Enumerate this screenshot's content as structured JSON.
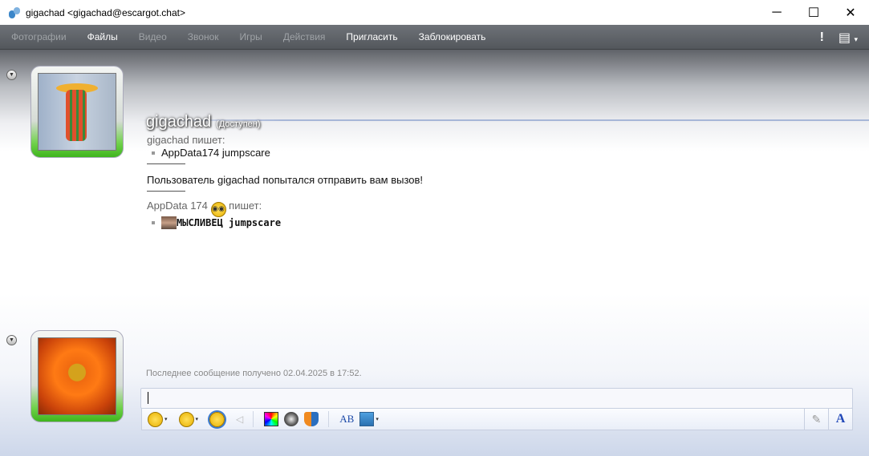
{
  "window": {
    "title": "gigachad <gigachad@escargot.chat>",
    "minimize": "─",
    "maximize": "☐",
    "close": "✕"
  },
  "menu": {
    "items": [
      {
        "label": "Фотографии",
        "enabled": false
      },
      {
        "label": "Файлы",
        "enabled": true
      },
      {
        "label": "Видео",
        "enabled": false
      },
      {
        "label": "Звонок",
        "enabled": false
      },
      {
        "label": "Игры",
        "enabled": false
      },
      {
        "label": "Действия",
        "enabled": false
      },
      {
        "label": "Пригласить",
        "enabled": true
      },
      {
        "label": "Заблокировать",
        "enabled": true
      }
    ],
    "alert": "!",
    "options_icon": "▤",
    "dropdown": "▾"
  },
  "contact": {
    "name": "gigachad",
    "status": "(Доступен)"
  },
  "conversation": {
    "msg1_sender": "gigachad пишет:",
    "msg1_text": "AppData174 jumpscare",
    "system": "Пользователь gigachad попытался отправить вам вызов!",
    "msg2_sender_name": "AppData 174",
    "msg2_sender_suffix": "пишет:",
    "msg2_text": "МЫСЛИВЕЦ jumpscare"
  },
  "last_message": "Последнее сообщение получено 02.04.2025 в 17:52.",
  "input": {
    "value": ""
  },
  "toolbar": {
    "arrow": "▾",
    "font_label": "A",
    "spell_label": "AB"
  }
}
